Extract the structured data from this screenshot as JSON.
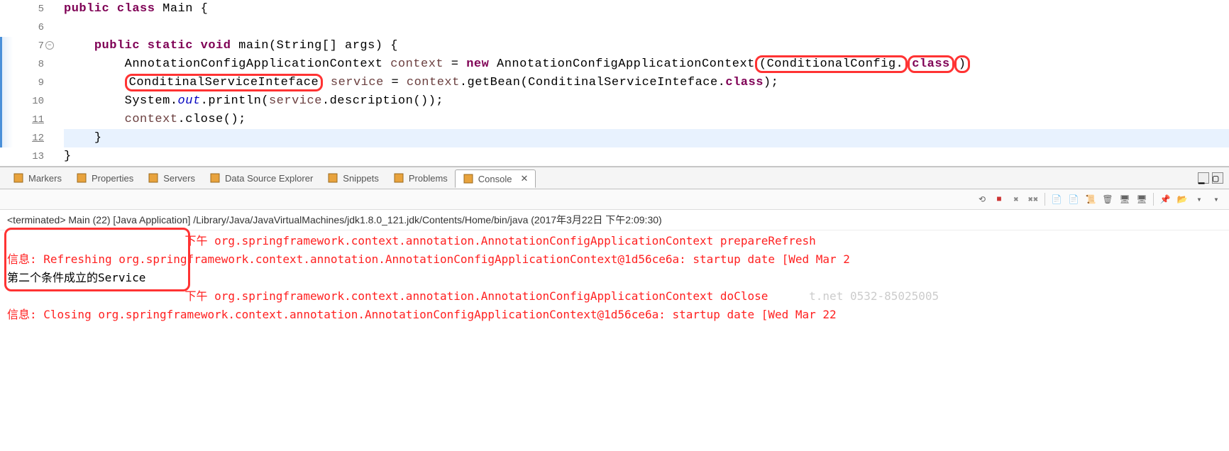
{
  "editor": {
    "lines": [
      {
        "num": "5",
        "marked": false,
        "fold": false,
        "current": false,
        "tokens": [
          {
            "cls": "kw",
            "t": "public"
          },
          {
            "cls": "plain",
            "t": " "
          },
          {
            "cls": "kw",
            "t": "class"
          },
          {
            "cls": "plain",
            "t": " Main {"
          }
        ]
      },
      {
        "num": "6",
        "marked": false,
        "fold": false,
        "current": false,
        "tokens": []
      },
      {
        "num": "7",
        "marked": true,
        "fold": true,
        "current": false,
        "indent": 1,
        "tokens": [
          {
            "cls": "kw",
            "t": "public"
          },
          {
            "cls": "plain",
            "t": " "
          },
          {
            "cls": "kw",
            "t": "static"
          },
          {
            "cls": "plain",
            "t": " "
          },
          {
            "cls": "kw",
            "t": "void"
          },
          {
            "cls": "plain",
            "t": " main(String[] args) {"
          }
        ]
      },
      {
        "num": "8",
        "marked": true,
        "fold": false,
        "current": false,
        "indent": 2,
        "tokens": [
          {
            "cls": "plain",
            "t": "AnnotationConfigApplicationContext "
          },
          {
            "cls": "var",
            "t": "context"
          },
          {
            "cls": "plain",
            "t": " = "
          },
          {
            "cls": "kw",
            "t": "new"
          },
          {
            "cls": "plain",
            "t": " AnnotationConfigApplicationContext"
          },
          {
            "cls": "plain",
            "hl": true,
            "t": "(ConditionalConfig."
          },
          {
            "cls": "kw",
            "hl": true,
            "t": "class"
          },
          {
            "cls": "plain",
            "hl": true,
            "t": ")"
          }
        ]
      },
      {
        "num": "9",
        "marked": true,
        "fold": false,
        "current": false,
        "indent": 2,
        "tokens": [
          {
            "cls": "plain",
            "hl": true,
            "t": "ConditinalServiceInteface"
          },
          {
            "cls": "plain",
            "t": " "
          },
          {
            "cls": "var",
            "t": "service"
          },
          {
            "cls": "plain",
            "t": " = "
          },
          {
            "cls": "var",
            "t": "context"
          },
          {
            "cls": "plain",
            "t": ".getBean(ConditinalServiceInteface."
          },
          {
            "cls": "kw",
            "t": "class"
          },
          {
            "cls": "plain",
            "t": ");"
          }
        ]
      },
      {
        "num": "10",
        "marked": true,
        "fold": false,
        "current": false,
        "indent": 2,
        "tokens": [
          {
            "cls": "plain",
            "t": "System."
          },
          {
            "cls": "field",
            "t": "out"
          },
          {
            "cls": "plain",
            "t": ".println("
          },
          {
            "cls": "var",
            "t": "service"
          },
          {
            "cls": "plain",
            "t": ".description());"
          }
        ]
      },
      {
        "num": "11",
        "marked": true,
        "fold": false,
        "current": false,
        "indent": 2,
        "tokens": [
          {
            "cls": "var",
            "t": "context"
          },
          {
            "cls": "plain",
            "t": ".close();"
          }
        ]
      },
      {
        "num": "12",
        "marked": true,
        "fold": false,
        "current": true,
        "indent": 1,
        "tokens": [
          {
            "cls": "plain",
            "t": "}"
          }
        ]
      },
      {
        "num": "13",
        "marked": false,
        "fold": false,
        "current": false,
        "tokens": [
          {
            "cls": "plain",
            "t": "}"
          }
        ]
      }
    ]
  },
  "views": {
    "tabs": [
      {
        "label": "Markers",
        "icon": "markers-icon"
      },
      {
        "label": "Properties",
        "icon": "properties-icon"
      },
      {
        "label": "Servers",
        "icon": "servers-icon"
      },
      {
        "label": "Data Source Explorer",
        "icon": "datasource-icon"
      },
      {
        "label": "Snippets",
        "icon": "snippets-icon"
      },
      {
        "label": "Problems",
        "icon": "problems-icon"
      },
      {
        "label": "Console",
        "icon": "console-icon",
        "active": true,
        "close": "✕"
      }
    ]
  },
  "console": {
    "header": "<terminated> Main (22) [Java Application] /Library/Java/JavaVirtualMachines/jdk1.8.0_121.jdk/Contents/Home/bin/java (2017年3月22日 下午2:09:30)",
    "lines": [
      {
        "cls": "log-err",
        "prefix": "",
        "text": "下午 org.springframework.context.annotation.AnnotationConfigApplicationContext prepareRefresh",
        "pad": "                          "
      },
      {
        "cls": "log-err",
        "text": "信息: Refreshing org.springframework.context.annotation.AnnotationConfigApplicationContext@1d56ce6a: startup date [Wed Mar 2"
      },
      {
        "cls": "log-out",
        "text": "第二个条件成立的Service"
      },
      {
        "cls": "log-err",
        "prefix": "",
        "text": "下午 org.springframework.context.annotation.AnnotationConfigApplicationContext doClose",
        "pad": "                          ",
        "watermark": "t.net 0532-85025005"
      },
      {
        "cls": "log-err",
        "text": "信息: Closing org.springframework.context.annotation.AnnotationConfigApplicationContext@1d56ce6a: startup date [Wed Mar 22 "
      }
    ]
  },
  "toolbar_icons": [
    "refresh",
    "stop",
    "remove-x",
    "remove-xx",
    "sep",
    "doc-lock",
    "doc-green",
    "scroll",
    "clear",
    "display",
    "display2",
    "sep",
    "pin",
    "open",
    "dropdown",
    "dropdown2"
  ]
}
